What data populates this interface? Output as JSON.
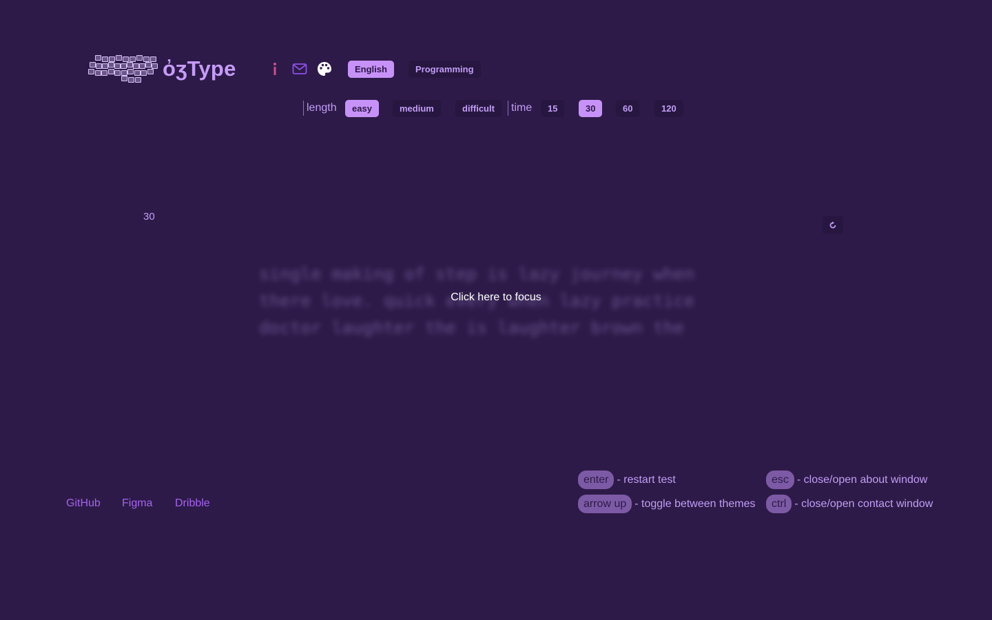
{
  "app": {
    "logo_text": "ὀʒType",
    "languages": [
      {
        "label": "English",
        "active": true
      },
      {
        "label": "Programming",
        "active": false
      }
    ]
  },
  "icons": {
    "info": "info-icon",
    "mail": "mail-icon",
    "theme": "palette-icon",
    "restart": "restart-icon"
  },
  "options": {
    "length_label": "length",
    "length": [
      {
        "label": "easy",
        "active": true
      },
      {
        "label": "medium",
        "active": false
      },
      {
        "label": "difficult",
        "active": false
      }
    ],
    "time_label": "time",
    "time": [
      {
        "label": "15",
        "active": false
      },
      {
        "label": "30",
        "active": true
      },
      {
        "label": "60",
        "active": false
      },
      {
        "label": "120",
        "active": false
      }
    ]
  },
  "test": {
    "timer": "30",
    "lines": [
      "single making of step is lazy journey when",
      "there love. quick every when lazy practice",
      "doctor laughter the is laughter brown the"
    ],
    "focus_message": "Click here to focus"
  },
  "footer": {
    "links": [
      "GitHub",
      "Figma",
      "Dribble"
    ],
    "hints": [
      {
        "key": "enter",
        "text": "- restart test"
      },
      {
        "key": "esc",
        "text": "- close/open about window"
      },
      {
        "key": "arrow up",
        "text": "- toggle between themes"
      },
      {
        "key": "ctrl",
        "text": "- close/open contact window"
      }
    ]
  },
  "colors": {
    "background": "#2d1a48",
    "accent": "#c792f8",
    "text": "#c19ef5",
    "link": "#a463f0",
    "info_icon": "#d04d8e",
    "mail_icon": "#8e4fe8"
  }
}
